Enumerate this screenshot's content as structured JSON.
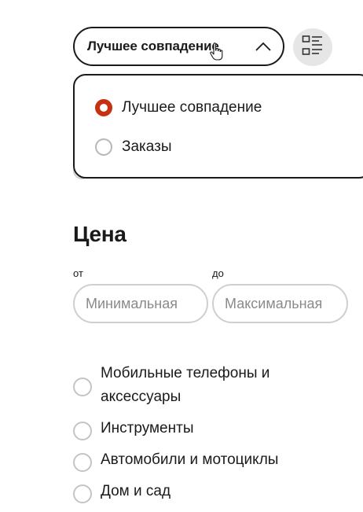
{
  "sort": {
    "label": "Лучшее совпадение",
    "options": [
      {
        "label": "Лучшее совпадение",
        "selected": true
      },
      {
        "label": "Заказы",
        "selected": false
      }
    ]
  },
  "price": {
    "title": "Цена",
    "from_label": "от",
    "to_label": "до",
    "min_placeholder": "Минимальная",
    "max_placeholder": "Максимальная"
  },
  "categories": [
    "Мобильные телефоны и аксессуары",
    "Инструменты",
    "Автомобили и мотоциклы",
    "Дом и сад"
  ],
  "colors": {
    "accent": "#c8310f",
    "border": "#1a1a1a",
    "muted_border": "#cfcfcf"
  }
}
